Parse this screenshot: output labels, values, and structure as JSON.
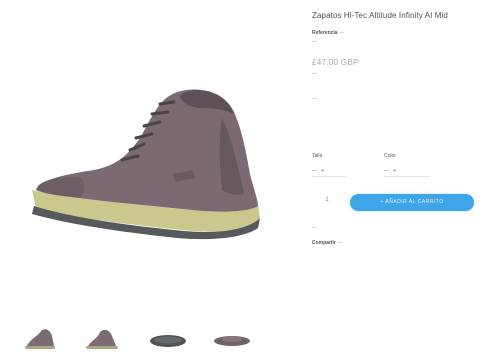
{
  "product": {
    "title": "Zapatos Hi-Tec Altitude Infinity AI Mid",
    "reference_label": "Referencia",
    "reference_value": "—",
    "availability": "—",
    "price": "£47.00 GBP",
    "price_note": "—",
    "shipping_note": "—"
  },
  "options": {
    "size_label": "Talla",
    "size_value": "—",
    "color_label": "Color",
    "color_value": "—"
  },
  "cart": {
    "quantity": "1",
    "add_button_label": "+ AÑADIR AL CARRITO"
  },
  "links": {
    "wishlist": "—",
    "share_label": "Compartir",
    "share_value": "—"
  },
  "gallery": {
    "main_alt": "boot-main-image",
    "thumbnails": [
      "thumb-1",
      "thumb-2",
      "thumb-3",
      "thumb-4"
    ]
  }
}
